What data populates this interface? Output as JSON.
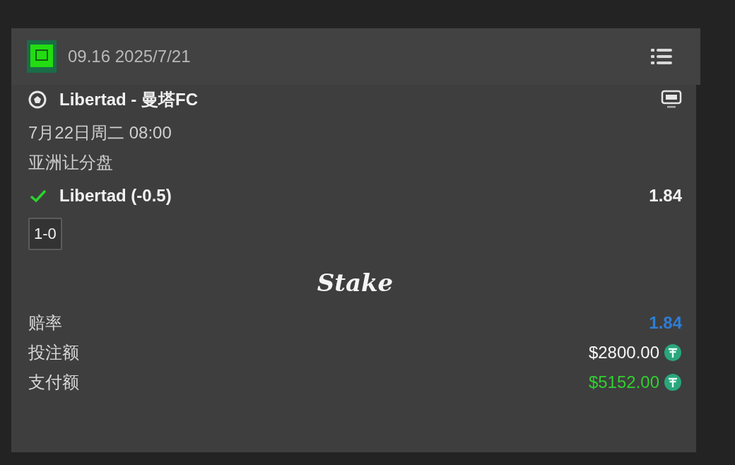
{
  "header": {
    "time": "09.16 2025/7/21"
  },
  "match": {
    "title": "Libertad - 曼塔FC",
    "date": "7月22日周二 08:00",
    "market": "亚洲让分盘"
  },
  "selection": {
    "name": "Libertad (-0.5)",
    "odds": "1.84",
    "won": true
  },
  "score": "1-0",
  "brand": "Stake",
  "summary": [
    {
      "label": "赔率",
      "value": "1.84",
      "kind": "odds"
    },
    {
      "label": "投注额",
      "value": "$2800.00",
      "kind": "stake"
    },
    {
      "label": "支付额",
      "value": "$5152.00",
      "kind": "payout"
    }
  ]
}
